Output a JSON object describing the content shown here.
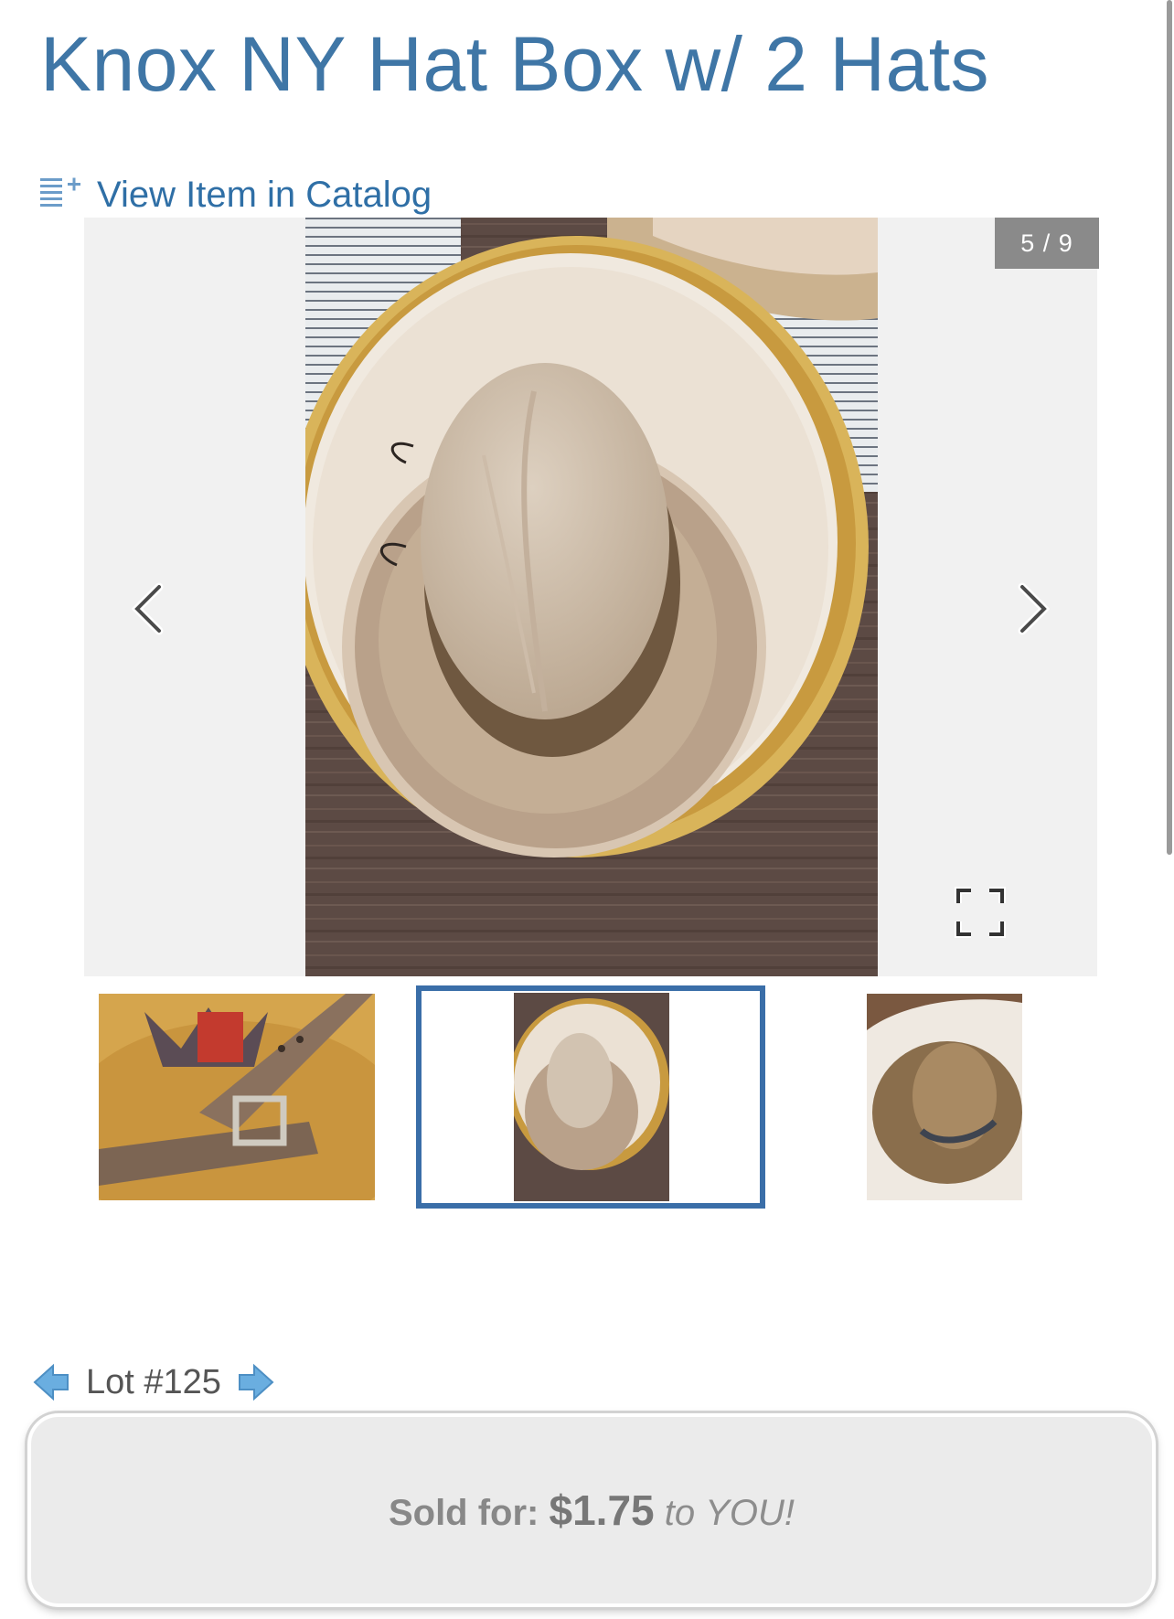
{
  "item": {
    "title": "Knox NY Hat Box w/ 2 Hats",
    "catalog_link": "View Item in Catalog"
  },
  "gallery": {
    "counter": "5 / 9",
    "current": 5,
    "total": 9,
    "thumbnails": [
      {
        "description": "belt-on-hatbox-lid"
      },
      {
        "description": "hat-in-box",
        "selected": true
      },
      {
        "description": "worn-hat-in-box"
      }
    ]
  },
  "lot": {
    "label": "Lot #125"
  },
  "result": {
    "sold_label": "Sold for:",
    "price": "$1.75",
    "to": "to",
    "buyer": "YOU!"
  },
  "colors": {
    "title": "#3f76a6",
    "link": "#2f6fa6",
    "thumb_border": "#3a6ea8",
    "counter_bg": "#8a8a8a",
    "sold_bg": "#ebebeb"
  }
}
